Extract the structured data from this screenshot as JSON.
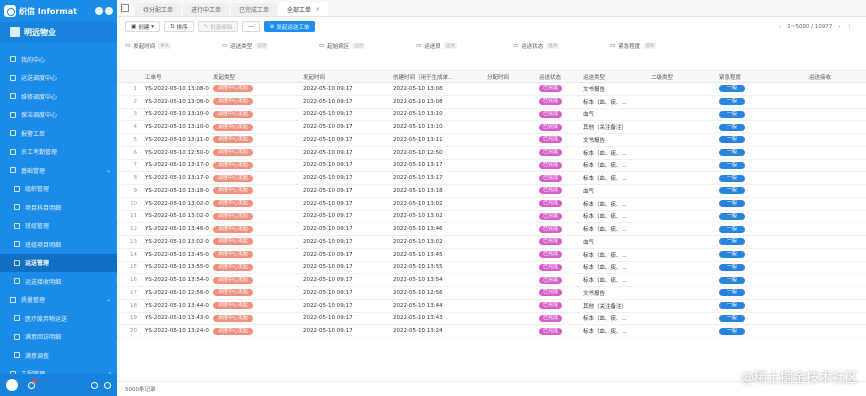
{
  "brand": {
    "name": "织信 Informat",
    "org": "明远物业"
  },
  "sidebar": {
    "items": [
      {
        "label": "我的中心",
        "type": "top"
      },
      {
        "label": "运送调度中心",
        "type": "top"
      },
      {
        "label": "维修调度中心",
        "type": "top"
      },
      {
        "label": "保洁调度中心",
        "type": "top"
      },
      {
        "label": "报警工单",
        "type": "top"
      },
      {
        "label": "员工考勤管理",
        "type": "top"
      },
      {
        "label": "基础管理",
        "type": "group",
        "arrow": "⌄"
      },
      {
        "label": "组织管理",
        "type": "sub"
      },
      {
        "label": "项目科目明细",
        "type": "sub"
      },
      {
        "label": "班组管理",
        "type": "sub"
      },
      {
        "label": "班组项目明细",
        "type": "sub"
      },
      {
        "label": "运送管理",
        "type": "sub",
        "active": true
      },
      {
        "label": "运送接收明细",
        "type": "sub"
      },
      {
        "label": "质量管理",
        "type": "group",
        "arrow": "⌄"
      },
      {
        "label": "医疗废弃物运送",
        "type": "sub"
      },
      {
        "label": "满意回访明细",
        "type": "sub"
      },
      {
        "label": "满意调查",
        "type": "sub"
      },
      {
        "label": "工程管理",
        "type": "group",
        "arrow": "›"
      }
    ]
  },
  "tabs": [
    {
      "label": "待分配工单",
      "active": false
    },
    {
      "label": "进行中工单",
      "active": false
    },
    {
      "label": "已完成工单",
      "active": false
    },
    {
      "label": "全部工单",
      "active": true,
      "close": "×"
    }
  ],
  "toolbar": {
    "create": "创建",
    "sort": "排序",
    "batch_edit": "批量编辑",
    "dash": "—",
    "launch": "发起运送工单",
    "pager": "1~5000 / 10977"
  },
  "filters": [
    {
      "label": "发起时间",
      "tag": "单天"
    },
    {
      "label": "运送类型",
      "tag": "选项"
    },
    {
      "label": "起始病区",
      "tag": "选项"
    },
    {
      "label": "运送员",
      "tag": "选项"
    },
    {
      "label": "运送状态",
      "tag": "选项"
    },
    {
      "label": "紧急程度",
      "tag": "选项"
    }
  ],
  "table": {
    "columns": [
      "",
      "工单号",
      "发起类型",
      "发起时间",
      "创建时间（用于生成单...",
      "分配时间",
      "运送状态",
      "运送类型",
      "二级类型",
      "紧急程度",
      "运送接收"
    ],
    "rows": [
      [
        "1",
        "YS-2022-05-10 13:08-0076",
        "调度中心发起",
        "2022-05-10 09:17",
        "2022-05-10 13:08",
        "",
        "已完成",
        "文书报告",
        "",
        "一般"
      ],
      [
        "2",
        "YS-2022-05-10 13:08-0080",
        "调度中心发起",
        "2022-05-10 09:17",
        "2022-05-10 13:08",
        "",
        "已完成",
        "标本（血、痰、...",
        "",
        "一般"
      ],
      [
        "3",
        "YS-2022-05-10 13:10-0081",
        "调度中心发起",
        "2022-05-10 09:17",
        "2022-05-10 13:10",
        "",
        "已完成",
        "血气",
        "",
        "一般"
      ],
      [
        "4",
        "YS-2022-05-10 13:10-0082",
        "调度中心发起",
        "2022-05-10 09:17",
        "2022-05-10 13:10",
        "",
        "已完成",
        "其他（关注备注）",
        "",
        "一般"
      ],
      [
        "5",
        "YS-2022-05-10 13:11-0084",
        "调度中心发起",
        "2022-05-10 09:17",
        "2022-05-10 13:11",
        "",
        "已完成",
        "文书报告",
        "",
        "一般"
      ],
      [
        "6",
        "YS-2022-05-10 12:50-0045",
        "调度中心发起",
        "2022-05-10 09:17",
        "2022-05-10 12:50",
        "",
        "已完成",
        "标本（血、痰、...",
        "",
        "一般"
      ],
      [
        "7",
        "YS-2022-05-10 13:17-0087",
        "调度中心发起",
        "2022-05-10 09:17",
        "2022-05-10 13:17",
        "",
        "已完成",
        "标本（血、痰、...",
        "",
        "一般"
      ],
      [
        "8",
        "YS-2022-05-10 13:17-0086",
        "调度中心发起",
        "2022-05-10 09:17",
        "2022-05-10 13:17",
        "",
        "已完成",
        "标本（血、痰、...",
        "",
        "一般"
      ],
      [
        "9",
        "YS-2022-05-10 13:18-0088",
        "调度中心发起",
        "2022-05-10 09:17",
        "2022-05-10 13:18",
        "",
        "已完成",
        "血气",
        "",
        "一般"
      ],
      [
        "10",
        "YS-2022-05-10 13:02-0060",
        "调度中心发起",
        "2022-05-10 09:17",
        "2022-05-10 13:02",
        "",
        "已完成",
        "标本（血、痰、...",
        "",
        "一般"
      ],
      [
        "11",
        "YS-2022-05-10 13:02-0059",
        "调度中心发起",
        "2022-05-10 09:17",
        "2022-05-10 13:02",
        "",
        "已完成",
        "标本（血、痰、...",
        "",
        "一般"
      ],
      [
        "12",
        "YS-2022-05-10 13:46-0129",
        "调度中心发起",
        "2022-05-10 09:17",
        "2022-05-10 13:46",
        "",
        "已完成",
        "标本（血、痰、...",
        "",
        "一般"
      ],
      [
        "13",
        "YS-2022-05-10 13:02-0058",
        "调度中心发起",
        "2022-05-10 09:17",
        "2022-05-10 13:02",
        "",
        "已完成",
        "血气",
        "",
        "一般"
      ],
      [
        "14",
        "YS-2022-05-10 13:45-0128",
        "调度中心发起",
        "2022-05-10 09:17",
        "2022-05-10 13:45",
        "",
        "已完成",
        "标本（血、痰、...",
        "",
        "一般"
      ],
      [
        "15",
        "YS-2022-05-10 13:55-0151",
        "调度中心发起",
        "2022-05-10 09:17",
        "2022-05-10 13:55",
        "",
        "已完成",
        "标本（血、痰、...",
        "",
        "一般"
      ],
      [
        "16",
        "YS-2022-05-10 13:54-0147",
        "调度中心发起",
        "2022-05-10 09:17",
        "2022-05-10 13:54",
        "",
        "已完成",
        "标本（血、痰、...",
        "",
        "一般"
      ],
      [
        "17",
        "YS-2022-05-10 12:56-0056",
        "调度中心发起",
        "2022-05-10 09:17",
        "2022-05-10 12:56",
        "",
        "已完成",
        "文书报告",
        "",
        "一般"
      ],
      [
        "18",
        "YS-2022-05-10 13:44-0127",
        "调度中心发起",
        "2022-05-10 09:17",
        "2022-05-10 13:44",
        "",
        "已完成",
        "其他（关注备注）",
        "",
        "一般"
      ],
      [
        "19",
        "YS-2022-05-10 13:43-0126",
        "调度中心发起",
        "2022-05-10 09:17",
        "2022-05-10 13:43",
        "",
        "已完成",
        "标本（血、痰、...",
        "",
        "一般"
      ],
      [
        "20",
        "YS-2022-05-10 13:24-0105",
        "调度中心发起",
        "2022-05-10 09:17",
        "2022-05-10 13:24",
        "",
        "已完成",
        "标本（血、痰、...",
        "",
        "一般"
      ]
    ]
  },
  "footer": {
    "count": "5000条记录"
  },
  "watermark": "@稀土掘金技术社区",
  "colors": {
    "sidebar": "#1a8be8",
    "primary": "#1e8ef0",
    "initiator_pill": "#f0907e",
    "status_pill": "#d65fc9",
    "urgency_pill": "#2b83e0"
  }
}
